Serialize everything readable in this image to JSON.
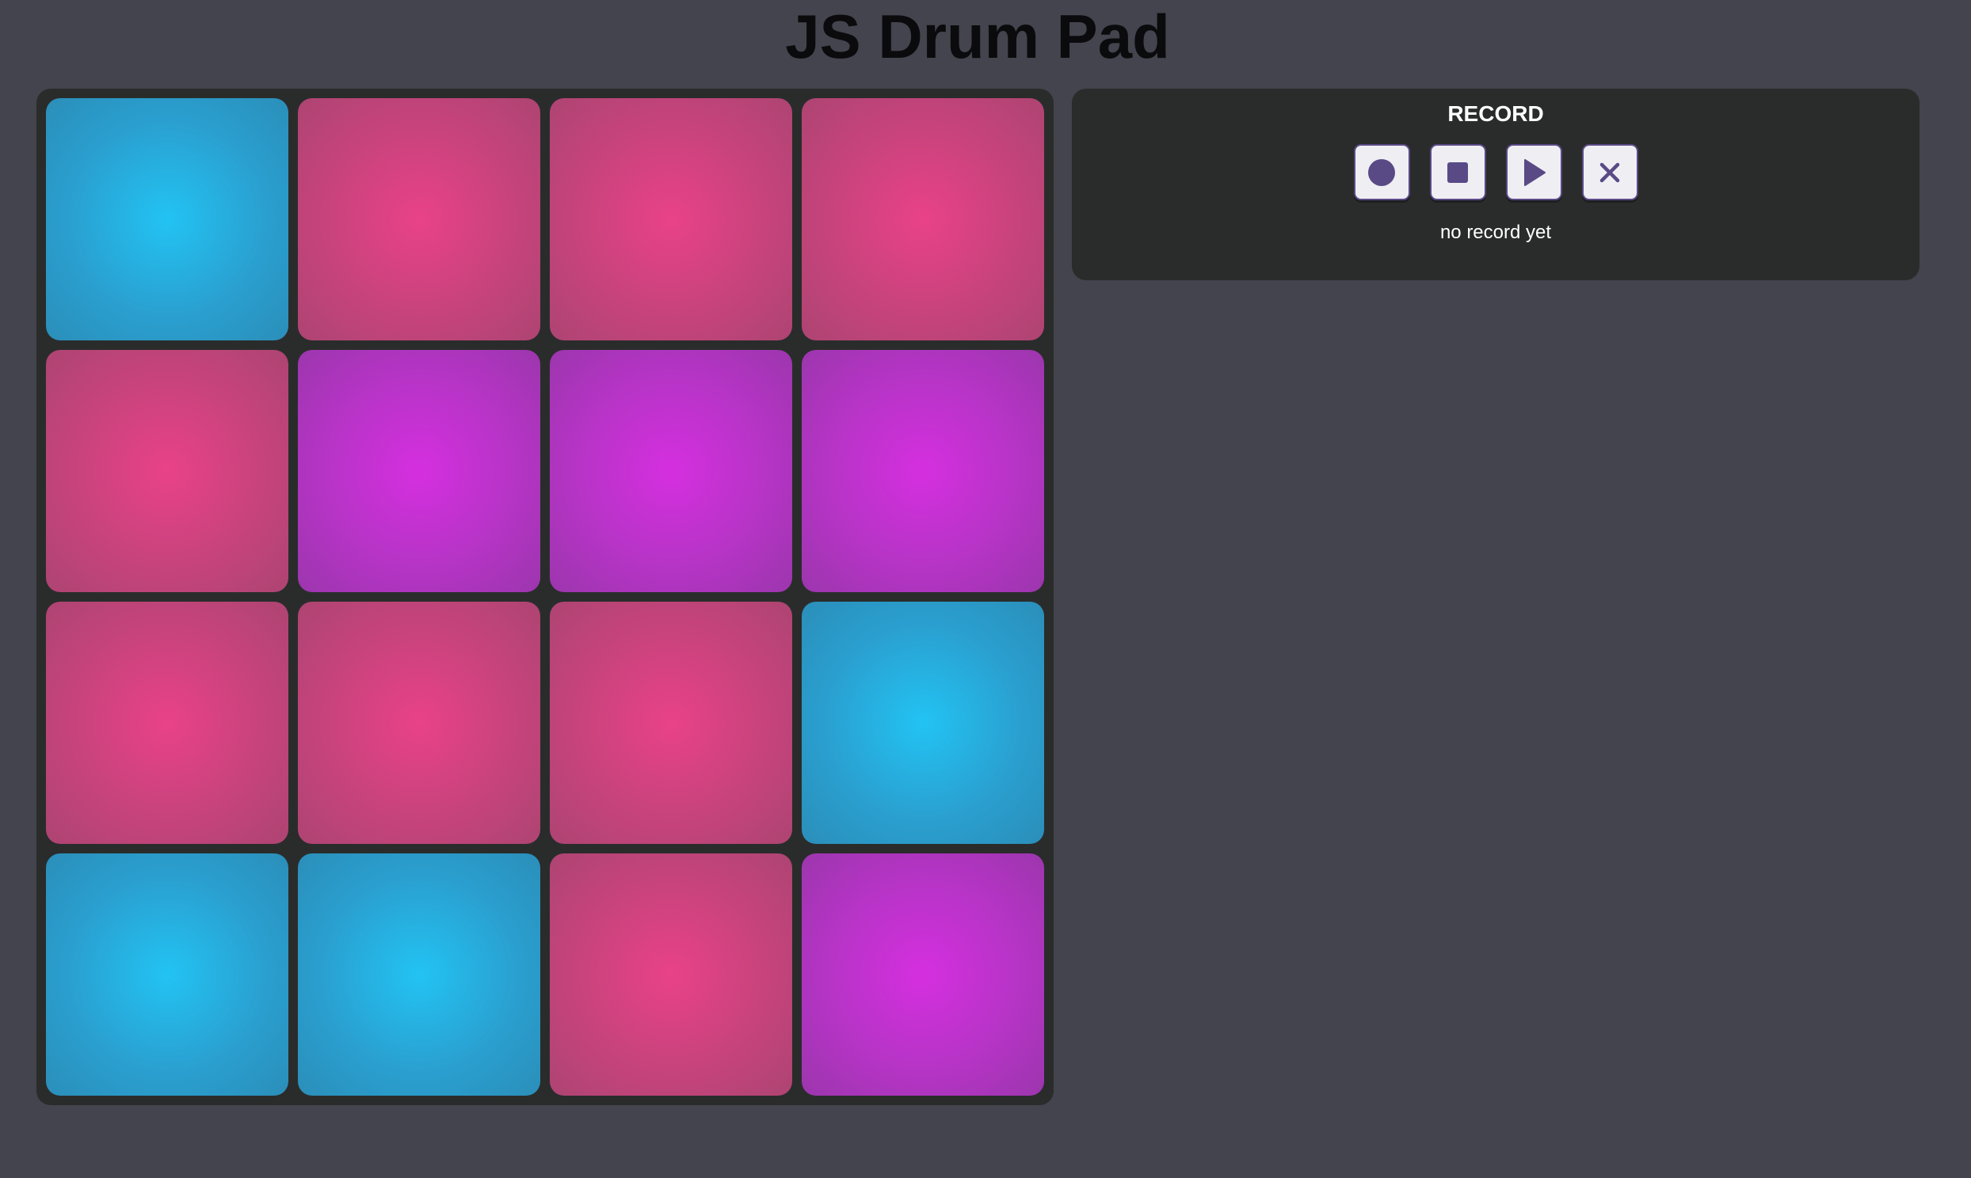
{
  "page": {
    "title": "JS Drum Pad"
  },
  "pads": [
    {
      "color": "blue"
    },
    {
      "color": "pink"
    },
    {
      "color": "pink"
    },
    {
      "color": "pink"
    },
    {
      "color": "pink"
    },
    {
      "color": "purple"
    },
    {
      "color": "purple"
    },
    {
      "color": "purple"
    },
    {
      "color": "pink"
    },
    {
      "color": "pink"
    },
    {
      "color": "pink"
    },
    {
      "color": "blue"
    },
    {
      "color": "blue"
    },
    {
      "color": "blue"
    },
    {
      "color": "pink"
    },
    {
      "color": "purple"
    }
  ],
  "colors": {
    "background": "#43444d",
    "panel": "#2a2c2b",
    "blue_pad": "#22c3f3",
    "pink_pad": "#e94289",
    "purple_pad": "#d52fdf",
    "control_icon": "#594a86"
  },
  "record": {
    "title": "RECORD",
    "status": "no record yet",
    "controls": [
      {
        "icon": "record-circle-icon"
      },
      {
        "icon": "stop-square-icon"
      },
      {
        "icon": "play-triangle-icon"
      },
      {
        "icon": "close-x-icon"
      }
    ]
  }
}
